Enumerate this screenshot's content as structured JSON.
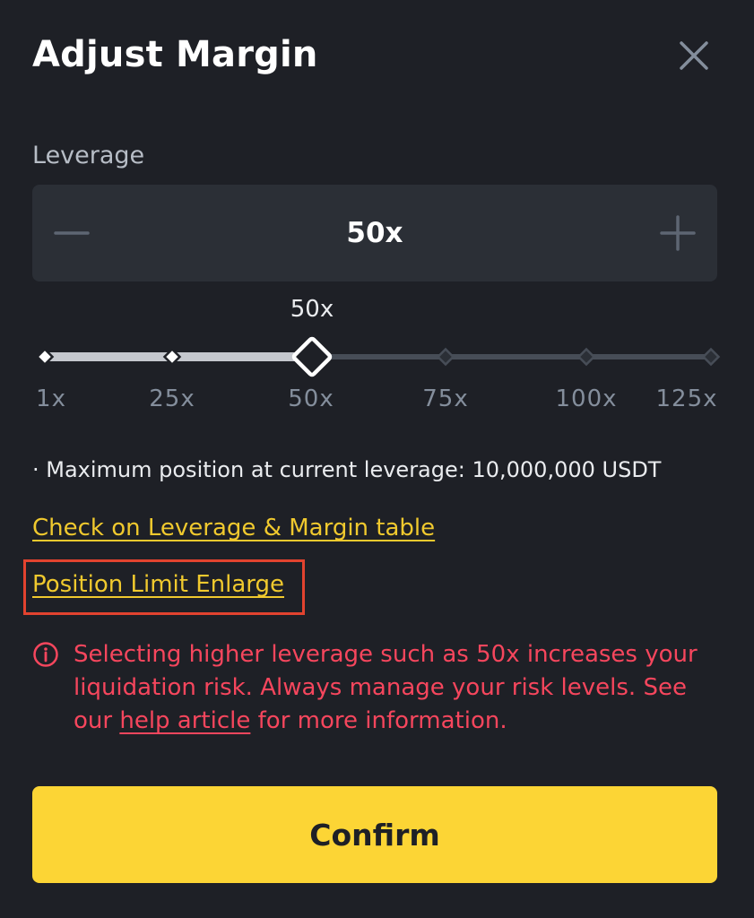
{
  "dialog": {
    "title": "Adjust Margin",
    "close_icon": "close-icon"
  },
  "leverage": {
    "label": "Leverage",
    "value": "50x",
    "minus_icon": "minus-icon",
    "plus_icon": "plus-icon"
  },
  "slider": {
    "current_label": "50x",
    "current_value": 50,
    "min": 1,
    "max": 125,
    "ticks": [
      "1x",
      "25x",
      "50x",
      "75x",
      "100x",
      "125x"
    ],
    "active_color": "#c5c8ce",
    "inactive_color": "#474d57"
  },
  "info": {
    "max_position": "· Maximum position at current leverage: 10,000,000 USDT"
  },
  "links": {
    "leverage_table": "Check on Leverage & Margin table",
    "position_limit": "Position Limit Enlarge"
  },
  "warning": {
    "icon": "info-circle-icon",
    "text_before": "Selecting higher leverage such as 50x increases your liquidation risk. Always manage your risk levels. See our ",
    "link": "help article",
    "text_after": " for more information.",
    "color": "#f6465d"
  },
  "confirm": {
    "label": "Confirm",
    "color": "#fcd535"
  },
  "highlight": {
    "color": "#e2432f"
  }
}
